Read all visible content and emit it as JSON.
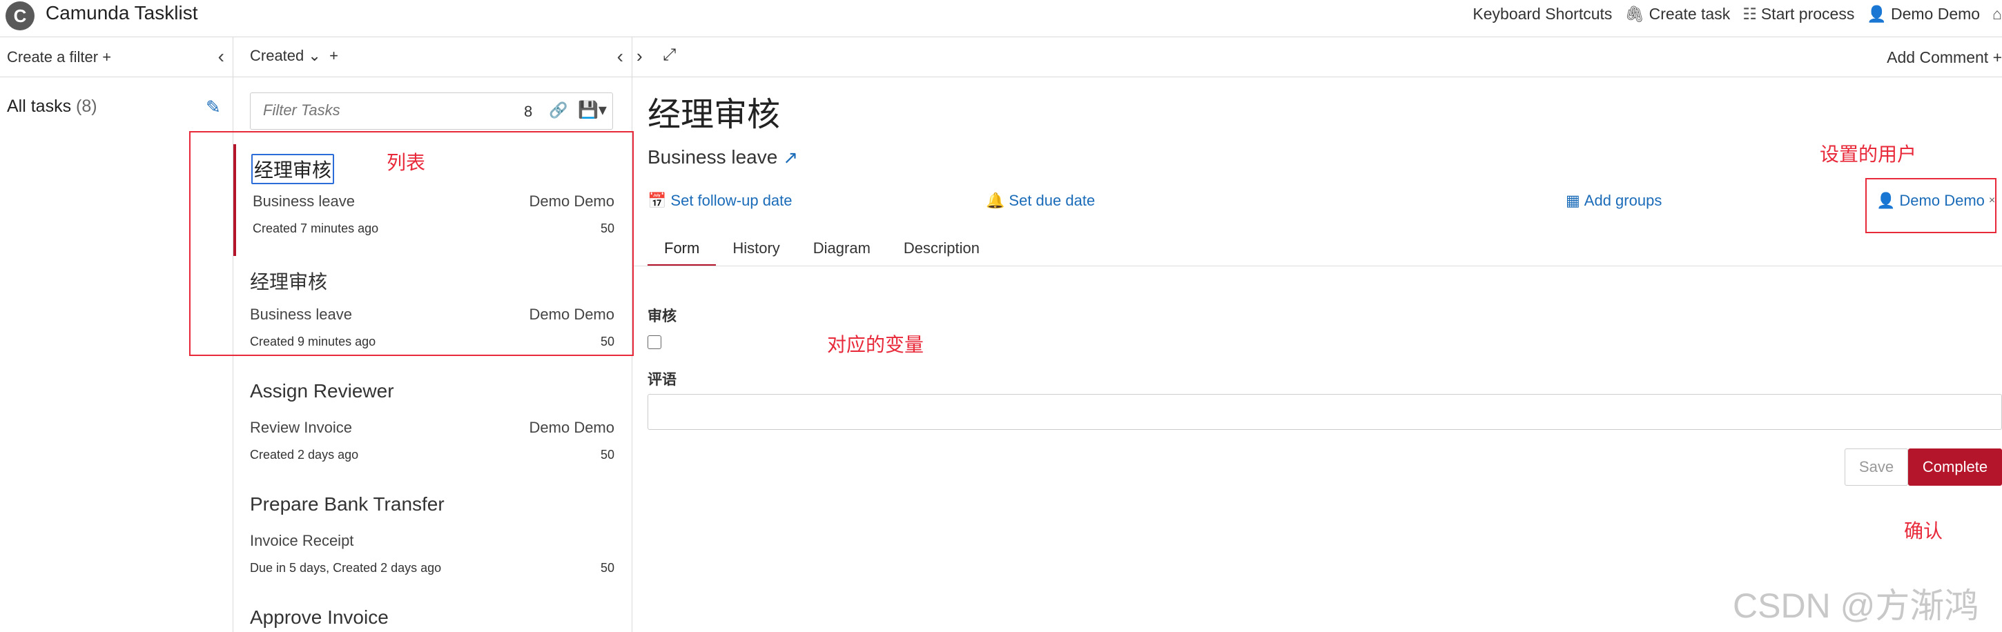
{
  "app": {
    "logo_letter": "C",
    "title": "Camunda Tasklist"
  },
  "topnav": {
    "keyboard_shortcuts": "Keyboard Shortcuts",
    "create_task": "Create task",
    "start_process": "Start process",
    "user": "Demo Demo"
  },
  "filters": {
    "create_label": "Create a filter",
    "items": [
      {
        "label": "All tasks",
        "count": "(8)"
      }
    ]
  },
  "list": {
    "sort_label": "Created",
    "search": {
      "placeholder": "Filter Tasks",
      "count": "8"
    },
    "tasks": [
      {
        "name": "经理审核",
        "process": "Business leave",
        "assignee": "Demo Demo",
        "created": "Created 7 minutes ago",
        "priority": "50"
      },
      {
        "name": "经理审核",
        "process": "Business leave",
        "assignee": "Demo Demo",
        "created": "Created 9 minutes ago",
        "priority": "50"
      },
      {
        "name": "Assign Reviewer",
        "process": "Review Invoice",
        "assignee": "Demo Demo",
        "created": "Created 2 days ago",
        "priority": "50"
      },
      {
        "name": "Prepare Bank Transfer",
        "process": "Invoice Receipt",
        "assignee": "",
        "created": "Due in 5 days, Created 2 days ago",
        "priority": "50"
      },
      {
        "name": "Approve Invoice",
        "process": "",
        "assignee": "",
        "created": "",
        "priority": ""
      }
    ]
  },
  "detail": {
    "add_comment": "Add Comment",
    "title": "经理审核",
    "process": "Business leave",
    "actions": {
      "follow_up": "Set follow-up date",
      "due": "Set due date",
      "groups": "Add groups",
      "assignee": "Demo Demo",
      "remove": "×"
    },
    "tabs": [
      "Form",
      "History",
      "Diagram",
      "Description"
    ],
    "form": {
      "checkbox_label": "审核",
      "text_label": "评语",
      "text_value": ""
    },
    "buttons": {
      "save": "Save",
      "complete": "Complete"
    }
  },
  "annotations": {
    "list": "列表",
    "user": "设置的用户",
    "variables": "对应的变量",
    "confirm": "确认"
  },
  "watermark": "CSDN @方渐鸿",
  "colors": {
    "accent": "#b5152b",
    "link": "#1a6bb8",
    "annotation": "#e8293a"
  }
}
